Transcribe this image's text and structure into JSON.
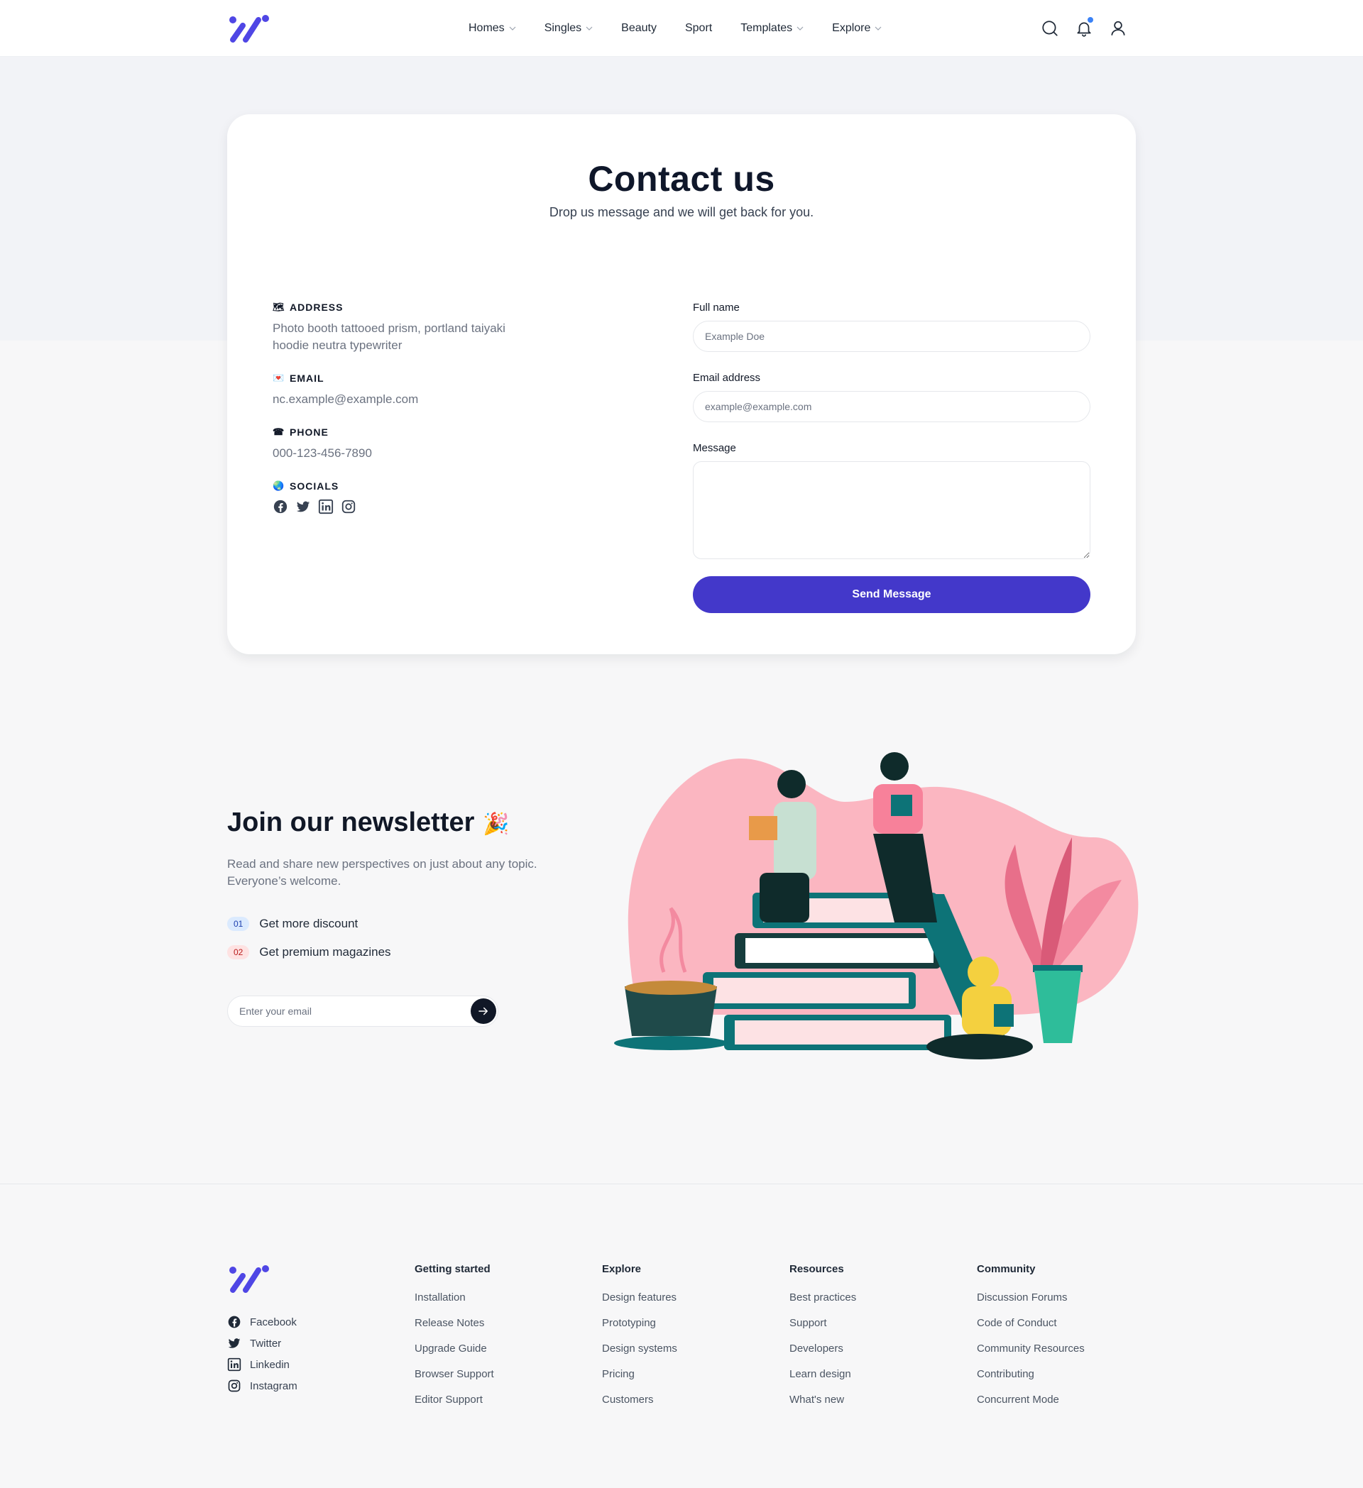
{
  "header": {
    "nav": [
      {
        "label": "Homes",
        "dropdown": true
      },
      {
        "label": "Singles",
        "dropdown": true
      },
      {
        "label": "Beauty",
        "dropdown": false
      },
      {
        "label": "Sport",
        "dropdown": false
      },
      {
        "label": "Templates",
        "dropdown": true
      },
      {
        "label": "Explore",
        "dropdown": true
      }
    ],
    "icons": [
      "search-icon",
      "bell-icon",
      "user-icon"
    ]
  },
  "contact": {
    "title": "Contact us",
    "subtitle": "Drop us message and we will get back for you.",
    "address_label": "ADDRESS",
    "address_value": "Photo booth tattooed prism, portland taiyaki hoodie neutra typewriter",
    "email_label": "EMAIL",
    "email_value": "nc.example@example.com",
    "phone_label": "PHONE",
    "phone_value": "000-123-456-7890",
    "socials_label": "SOCIALS",
    "form": {
      "fullname_label": "Full name",
      "fullname_placeholder": "Example Doe",
      "email_label": "Email address",
      "email_placeholder": "example@example.com",
      "message_label": "Message",
      "submit_label": "Send Message"
    }
  },
  "newsletter": {
    "title": "Join our newsletter",
    "emoji": "🎉",
    "description": "Read and share new perspectives on just about any topic. Everyone’s welcome.",
    "items": [
      {
        "num": "01",
        "text": "Get more discount"
      },
      {
        "num": "02",
        "text": "Get premium magazines"
      }
    ],
    "email_placeholder": "Enter your email"
  },
  "footer": {
    "socials": [
      "Facebook",
      "Twitter",
      "Linkedin",
      "Instagram"
    ],
    "columns": [
      {
        "title": "Getting started",
        "links": [
          "Installation",
          "Release Notes",
          "Upgrade Guide",
          "Browser Support",
          "Editor Support"
        ]
      },
      {
        "title": "Explore",
        "links": [
          "Design features",
          "Prototyping",
          "Design systems",
          "Pricing",
          "Customers"
        ]
      },
      {
        "title": "Resources",
        "links": [
          "Best practices",
          "Support",
          "Developers",
          "Learn design",
          "What's new"
        ]
      },
      {
        "title": "Community",
        "links": [
          "Discussion Forums",
          "Code of Conduct",
          "Community Resources",
          "Contributing",
          "Concurrent Mode"
        ]
      }
    ]
  },
  "colors": {
    "accent": "#4338ca",
    "illustration_pink": "#fbb6c1",
    "teal": "#0d7377"
  }
}
